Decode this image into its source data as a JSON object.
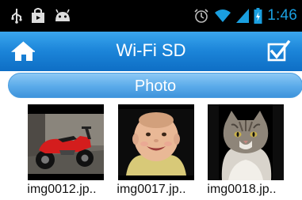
{
  "status_bar": {
    "time": "1:46",
    "icons": [
      "usb-icon",
      "shopping-bag-icon",
      "android-icon",
      "alarm-icon",
      "wifi-icon",
      "signal-icon",
      "battery-charging-icon"
    ]
  },
  "title_bar": {
    "title": "Wi-Fi SD",
    "left_icon": "home-icon",
    "right_icon": "select-checkbox-icon"
  },
  "section": {
    "title": "Photo"
  },
  "photos": [
    {
      "name": "img0012.jp..",
      "subject": "motorcycle"
    },
    {
      "name": "img0017.jp..",
      "subject": "baby"
    },
    {
      "name": "img0018.jp..",
      "subject": "cat"
    }
  ],
  "colors": {
    "status_time": "#1a9fe0",
    "title_bar": "#1b84d8",
    "section_header": "#5aaae9"
  }
}
